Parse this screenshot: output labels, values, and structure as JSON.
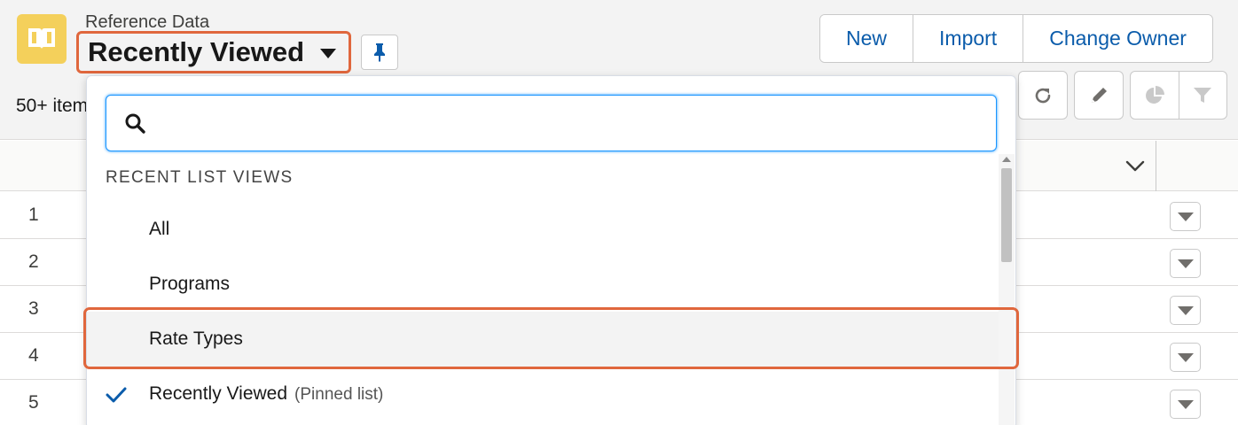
{
  "header": {
    "object_label": "Reference Data",
    "list_view_title": "Recently Viewed",
    "item_count": "50+ items",
    "actions": [
      "New",
      "Import",
      "Change Owner"
    ]
  },
  "table": {
    "rows": [
      "1",
      "2",
      "3",
      "4",
      "5"
    ]
  },
  "dropdown": {
    "search_value": "",
    "section_title": "RECENT LIST VIEWS",
    "items": [
      {
        "label": "All",
        "suffix": ""
      },
      {
        "label": "Programs",
        "suffix": ""
      },
      {
        "label": "Rate Types",
        "suffix": ""
      },
      {
        "label": "Recently Viewed",
        "suffix": "(Pinned list)"
      }
    ]
  },
  "colors": {
    "accent": "#0b5cab",
    "highlight": "#e0673d",
    "app_icon": "#f4d05b"
  },
  "icons": [
    "book-icon",
    "pin-icon",
    "search-icon",
    "refresh-icon",
    "pencil-icon",
    "chart-icon",
    "filter-icon",
    "chevron-down-icon",
    "checkmark-icon"
  ]
}
